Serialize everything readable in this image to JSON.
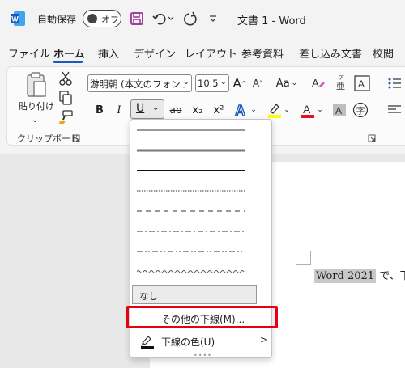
{
  "titlebar": {
    "autosave_label": "自動保存",
    "autosave_state": "オフ",
    "doc_title": "文書 1 - Word"
  },
  "tabs": [
    {
      "label": "ファイル"
    },
    {
      "label": "ホーム"
    },
    {
      "label": "挿入"
    },
    {
      "label": "デザイン"
    },
    {
      "label": "レイアウト"
    },
    {
      "label": "参考資料"
    },
    {
      "label": "差し込み文書"
    },
    {
      "label": "校閲"
    }
  ],
  "ribbon": {
    "paste_label_1": "貼り付け",
    "paste_label_2": "け",
    "clipboard_group": "クリップボード",
    "font_name": "游明朝 (本文のフォント",
    "font_size": "10.5",
    "bold": "B",
    "italic": "I",
    "underline": "U",
    "strike": "ab",
    "subscript": "x₂",
    "superscript": "x²",
    "aa": "Aa",
    "grow": "A",
    "shrink": "A"
  },
  "menu": {
    "none_label": "なし",
    "other_label": "その他の下線(M)...",
    "color_label": "下線の色(U)",
    "submenu_arrow": ">"
  },
  "document": {
    "selected_text": "Word 2021",
    "rest_text": "で、下"
  },
  "colors": {
    "accent": "#185abd",
    "highlight_border": "#e60012",
    "font_color_bar": "#e81123",
    "highlight_color_bar": "#ffff00"
  }
}
